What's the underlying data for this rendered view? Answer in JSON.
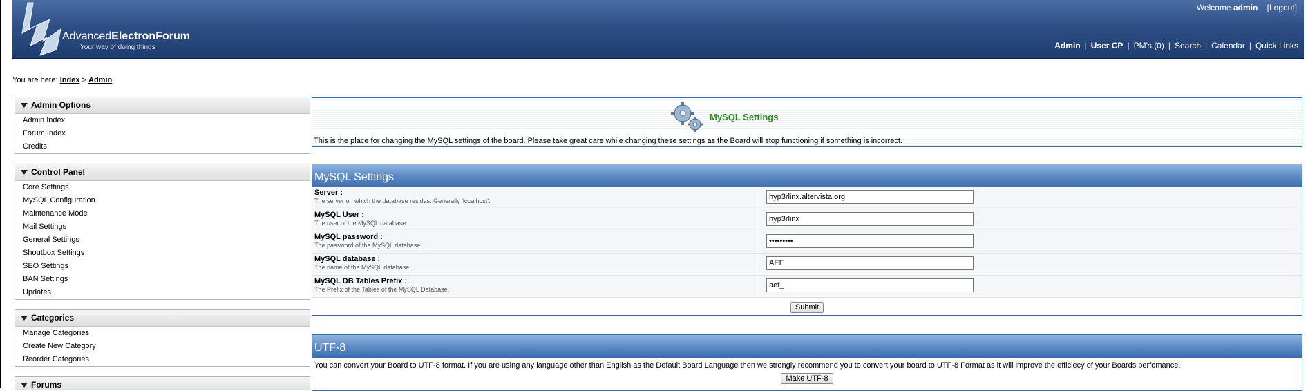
{
  "header": {
    "brand_light": "Advanced",
    "brand_bold": "ElectronForum",
    "tagline": "Your way of doing things",
    "welcome_prefix": "Welcome",
    "username": "admin",
    "logout_label": "[Logout]",
    "nav": {
      "admin": "Admin",
      "user_cp": "User CP",
      "pms": "PM's (0)",
      "search": "Search",
      "calendar": "Calendar",
      "quick_links": "Quick Links"
    }
  },
  "breadcrumb": {
    "prefix": "You are here:",
    "index": "Index",
    "separator": ">",
    "admin": "Admin"
  },
  "sidebar": {
    "admin_options": {
      "title": "Admin Options",
      "items": [
        "Admin Index",
        "Forum Index",
        "Credits"
      ]
    },
    "control_panel": {
      "title": "Control Panel",
      "items": [
        "Core Settings",
        "MySQL Configuration",
        "Maintenance Mode",
        "Mail Settings",
        "General Settings",
        "Shoutbox Settings",
        "SEO Settings",
        "BAN Settings",
        "Updates"
      ]
    },
    "categories": {
      "title": "Categories",
      "items": [
        "Manage Categories",
        "Create New Category",
        "Reorder Categories"
      ]
    },
    "forums": {
      "title": "Forums"
    }
  },
  "intro": {
    "title": "MySQL Settings",
    "description": "This is the place for changing the MySQL settings of the board. Please take great care while changing these settings as the Board will stop functioning if something is incorrect."
  },
  "mysql": {
    "header": "MySQL Settings",
    "fields": [
      {
        "label": "Server :",
        "desc": "The server on which the database resides. Generally 'localhost'.",
        "value": "hyp3rlinx.altervista.org"
      },
      {
        "label": "MySQL User :",
        "desc": "The user of the MySQL database.",
        "value": "hyp3rlinx"
      },
      {
        "label": "MySQL password :",
        "desc": "The password of the MySQL database.",
        "value": "•••••••••"
      },
      {
        "label": "MySQL database :",
        "desc": "The name of the MySQL database.",
        "value": "AEF"
      },
      {
        "label": "MySQL DB Tables Prefix :",
        "desc": "The Prefix of the Tables of the MySQL Database.",
        "value": "aef_"
      }
    ],
    "submit_label": "Submit"
  },
  "utf8": {
    "header": "UTF-8",
    "description": "You can convert your Board to UTF-8 format. If you are using any language other than English as the Default Board Language then we strongly recommend you to convert your board to UTF-8 Format as it will improve the efficiecy of your Boards perfomance.",
    "button_label": "Make UTF-8"
  },
  "colors": {
    "header_blue": "#2e4f86",
    "panel_border": "#3d6aa0",
    "title_green": "#2f8a26"
  }
}
